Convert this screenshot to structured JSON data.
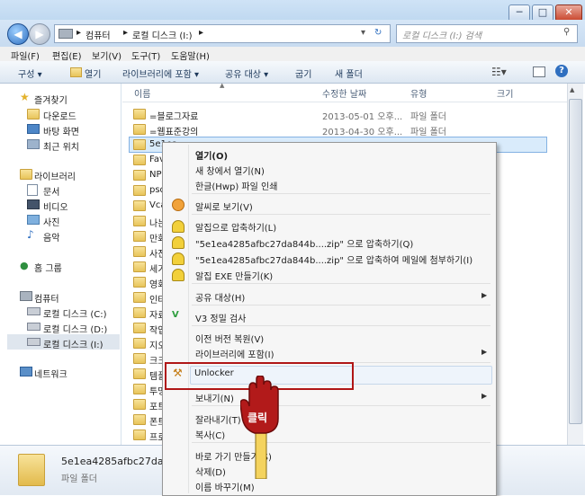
{
  "window": {
    "minimize": "─",
    "maximize": "□",
    "close": "✕"
  },
  "address": {
    "crumb1": "컴퓨터",
    "crumb2": "로컬 디스크 (I:)",
    "search_placeholder": "로컬 디스크 (I:) 검색"
  },
  "menu": [
    "파일(F)",
    "편집(E)",
    "보기(V)",
    "도구(T)",
    "도움말(H)"
  ],
  "commands": {
    "organize": "구성 ▾",
    "open": "열기",
    "library": "라이브러리에 포함 ▾",
    "share": "공유 대상 ▾",
    "burn": "굽기",
    "newfolder": "새 폴더"
  },
  "nav": {
    "favorites": "즐겨찾기",
    "downloads": "다운로드",
    "desktop": "바탕 화면",
    "recent": "최근 위치",
    "libraries": "라이브러리",
    "docs": "문서",
    "video": "비디오",
    "pictures": "사진",
    "music": "음악",
    "homegroup": "홈 그룹",
    "computer": "컴퓨터",
    "driveC": "로컬 디스크 (C:)",
    "driveD": "로컬 디스크 (D:)",
    "driveI": "로컬 디스크 (I:)",
    "network": "네트워크"
  },
  "columns": {
    "name": "이름",
    "date": "수정한 날짜",
    "type": "유형",
    "size": "크기"
  },
  "files": {
    "r1": {
      "name": "=블로그자료",
      "date": "2013-05-01 오후...",
      "type": "파일 폴더"
    },
    "r2": {
      "name": "=웹표준강의",
      "date": "2013-04-30 오후...",
      "type": "파일 폴더"
    },
    "r3": {
      "name": "5e1ea"
    },
    "r4": "Favor",
    "r5": "NPKI",
    "r6": "psd",
    "r7": "Vcard",
    "r8": "나는",
    "r9": "만화",
    "r10": "사진",
    "r11": "세기",
    "r12": "영화",
    "r13": "인터",
    "r14": "자료",
    "r15": "작업",
    "r16": "지오",
    "r17": "크크",
    "r18": "템플",
    "r19": "투명",
    "r20": "포트",
    "r21": "폰트",
    "r22": "프로",
    "r23": "프리"
  },
  "context_menu": {
    "open": "열기(O)",
    "open_new": "새 창에서 열기(N)",
    "hwp_print": "한글(Hwp) 파일 인쇄",
    "alsee": "알씨로 보기(V)",
    "alzip1": "알집으로 압축하기(L)",
    "alzip2": "\"5e1ea4285afbc27da844b....zip\" 으로 압축하기(Q)",
    "alzip3": "\"5e1ea4285afbc27da844b....zip\" 으로 압축하여 메일에 첨부하기(I)",
    "alzip_exe": "알집 EXE 만들기(K)",
    "share": "공유 대상(H)",
    "v3": "V3 정밀 검사",
    "restore": "이전 버전 복원(V)",
    "library": "라이브러리에 포함(I)",
    "unlocker": "Unlocker",
    "sendto": "보내기(N)",
    "cut": "잘라내기(T)",
    "copy": "복사(C)",
    "shortcut": "바로 가기 만들기(S)",
    "delete": "삭제(D)",
    "rename": "이름 바꾸기(M)"
  },
  "callout": "클릭",
  "details": {
    "name": "5e1ea4285afbc27da844bc",
    "type": "파일 폴더"
  }
}
